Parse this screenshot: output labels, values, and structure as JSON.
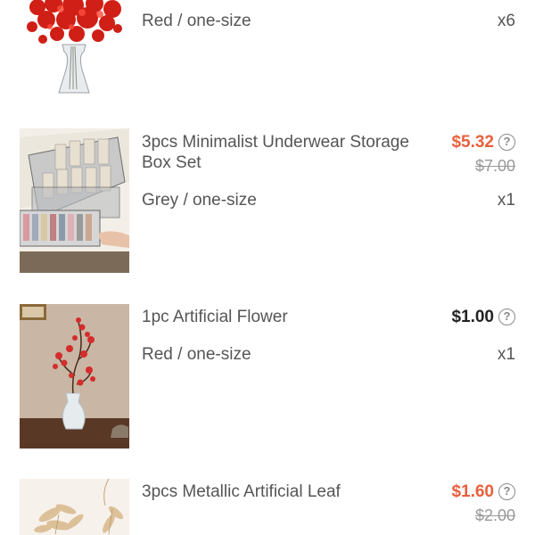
{
  "items": [
    {
      "variant": "Red / one-size",
      "quantity": "x6",
      "image_icon": "red-flower-bouquet-image"
    },
    {
      "title": "3pcs Minimalist Underwear Storage Box Set",
      "price": "$5.32",
      "original_price": "$7.00",
      "variant": "Grey / one-size",
      "quantity": "x1",
      "image_icon": "storage-box-image"
    },
    {
      "title": "1pc Artificial Flower",
      "price": "$1.00",
      "variant": "Red / one-size",
      "quantity": "x1",
      "image_icon": "artificial-flower-image"
    },
    {
      "title": "3pcs Metallic Artificial Leaf",
      "price": "$1.60",
      "original_price": "$2.00",
      "image_icon": "metallic-leaf-image"
    }
  ],
  "help_symbol": "?",
  "colors": {
    "sale_price": "#e8603c",
    "regular_price": "#222222",
    "muted_text": "#555555",
    "strikethrough": "#999999"
  }
}
